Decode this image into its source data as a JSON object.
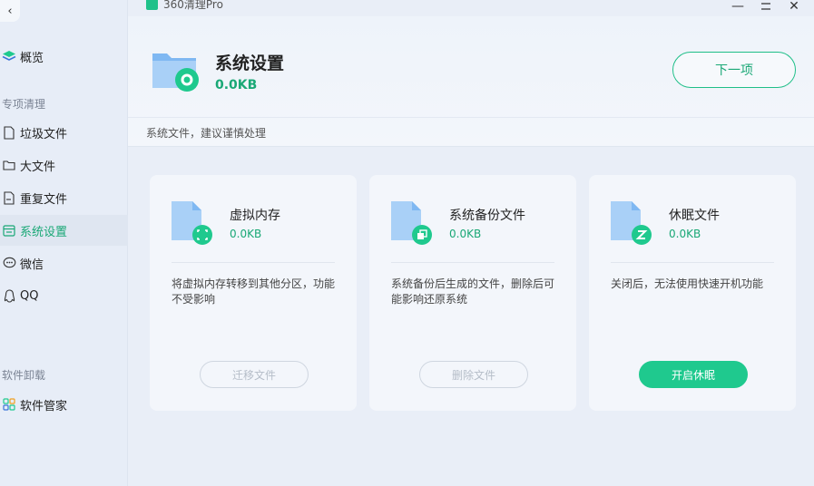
{
  "window": {
    "title": "360清理Pro",
    "minimize_glyph": "—",
    "close_glyph": "✕"
  },
  "sidebar": {
    "back_glyph": "‹",
    "overview": "概览",
    "section_clean": "专项清理",
    "items": [
      {
        "label": "垃圾文件",
        "icon": "file-icon"
      },
      {
        "label": "大文件",
        "icon": "folder-icon"
      },
      {
        "label": "重复文件",
        "icon": "duplicate-file-icon"
      },
      {
        "label": "系统设置",
        "icon": "system-settings-icon",
        "active": true
      },
      {
        "label": "微信",
        "icon": "wechat-icon"
      },
      {
        "label": "QQ",
        "icon": "qq-icon"
      }
    ],
    "section_uninstall": "软件卸载",
    "software_manager": "软件管家"
  },
  "header": {
    "title": "系统设置",
    "size": "0.0KB",
    "next_button": "下一项",
    "note": "系统文件，建议谨慎处理"
  },
  "cards": [
    {
      "title": "虚拟内存",
      "size": "0.0KB",
      "description": "将虚拟内存转移到其他分区，功能不受影响",
      "button": "迁移文件",
      "button_enabled": false,
      "badge_icon": "fullscreen-icon"
    },
    {
      "title": "系统备份文件",
      "size": "0.0KB",
      "description": "系统备份后生成的文件，删除后可能影响还原系统",
      "button": "删除文件",
      "button_enabled": false,
      "badge_icon": "copy-icon"
    },
    {
      "title": "休眠文件",
      "size": "0.0KB",
      "description": "关闭后，无法使用快速开机功能",
      "button": "开启休眠",
      "button_enabled": true,
      "badge_icon": "sleep-z-icon"
    }
  ],
  "colors": {
    "accent": "#1fc98e",
    "accent_text": "#1aa876"
  }
}
